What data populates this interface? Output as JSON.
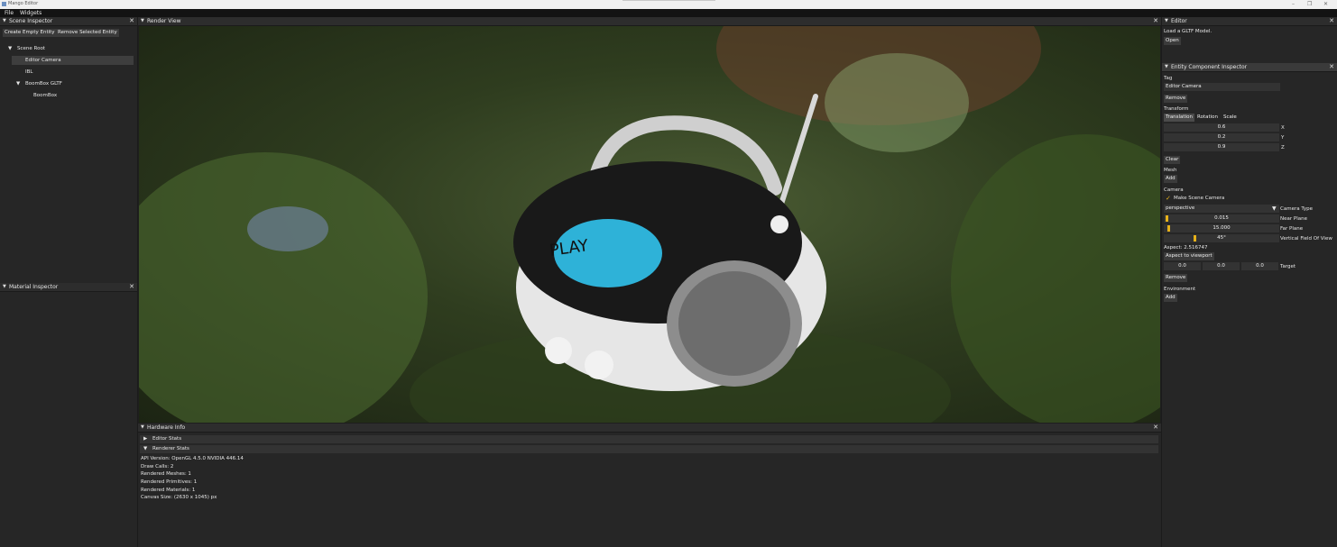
{
  "window": {
    "title": "Mango Editor",
    "controls": [
      "–",
      "❐",
      "✕"
    ]
  },
  "menubar": {
    "items": [
      "File",
      "Widgets"
    ]
  },
  "scene_inspector": {
    "title": "Scene Inspector",
    "create_button": "Create Empty Entity",
    "remove_button": "Remove Selected Entity",
    "tree": [
      {
        "label": "Scene Root",
        "arrow": "▼"
      },
      {
        "label": "Editor Camera",
        "arrow": ""
      },
      {
        "label": "IBL",
        "arrow": ""
      },
      {
        "label": "BoomBox GLTF",
        "arrow": "▼"
      },
      {
        "label": "BoomBox",
        "arrow": ""
      }
    ]
  },
  "material_inspector": {
    "title": "Material Inspector"
  },
  "render_view": {
    "title": "Render View",
    "display_text": "PLAY"
  },
  "hardware_info": {
    "title": "Hardware Info",
    "editor_stats": "Editor Stats",
    "renderer_stats": "Renderer Stats",
    "lines": [
      "API Version: OpenGL 4.5.0 NVIDIA 446.14",
      "Draw Calls: 2",
      "Rendered Meshes: 1",
      "Rendered Primitives: 1",
      "Rendered Materials: 1",
      "Canvas Size: (2630 x 1045) px"
    ]
  },
  "editor_panel": {
    "title": "Editor",
    "load_text": "Load a GLTF Model.",
    "open_button": "Open"
  },
  "entity_inspector": {
    "title": "Entity Component Inspector",
    "tag_label": "Tag",
    "tag_value": "Editor Camera",
    "remove_label": "Remove",
    "transform_label": "Transform",
    "transform_tabs": [
      "Translation",
      "Rotation",
      "Scale"
    ],
    "translation": {
      "x": "0.6",
      "y": "0.2",
      "z": "0.9"
    },
    "axis_labels": [
      "X",
      "Y",
      "Z"
    ],
    "clear_button": "Clear",
    "mesh_label": "Mesh",
    "add_label": "Add",
    "camera_label": "Camera",
    "make_scene_camera": "Make Scene Camera",
    "camera_type_value": "perspective",
    "camera_type_label": "Camera Type",
    "near_plane_value": "0.015",
    "near_plane_label": "Near Plane",
    "far_plane_value": "15.000",
    "far_plane_label": "Far Plane",
    "fov_value": "45°",
    "fov_label": "Vertical Field Of View",
    "aspect_text": "Aspect: 2.516747",
    "aspect_button": "Aspect to viewport",
    "target_values": [
      "0.0",
      "0.0",
      "0.0"
    ],
    "target_label": "Target",
    "environment_label": "Environment"
  },
  "colors": {
    "accent": "#e6b11a",
    "panel_bg": "#262626",
    "header_bg": "#2d2d2d",
    "button_bg": "#3b3b3b"
  }
}
